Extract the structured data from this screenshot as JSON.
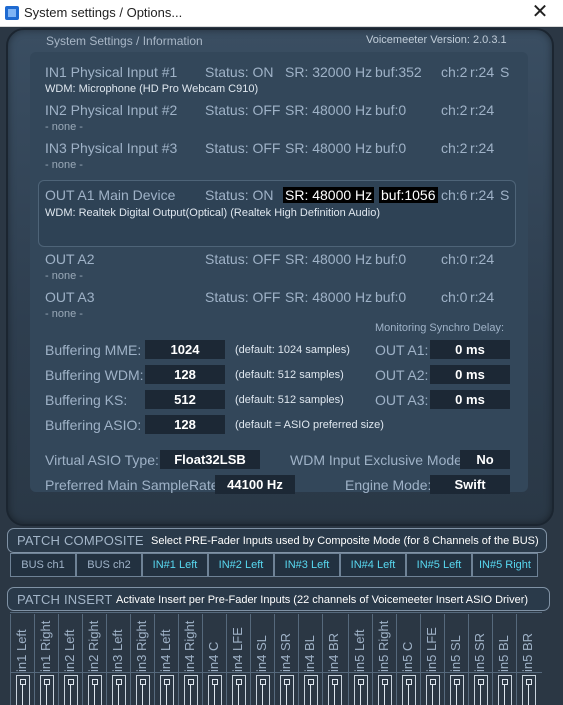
{
  "window": {
    "title": "System settings / Options...",
    "close": "✕"
  },
  "header": {
    "left": "System Settings / Information",
    "right": "Voicemeeter Version: 2.0.3.1"
  },
  "devices": [
    {
      "name": "IN1 Physical Input #1",
      "status": "Status: ON",
      "sr": "SR: 32000 Hz",
      "buf": "buf:352",
      "ch": "ch:2",
      "r": "r:24",
      "s": "S",
      "driver": "WDM: Microphone (HD Pro Webcam C910)"
    },
    {
      "name": "IN2 Physical Input #2",
      "status": "Status: OFF",
      "sr": "SR: 48000 Hz",
      "buf": "buf:0",
      "ch": "ch:2",
      "r": "r:24",
      "s": "",
      "driver": "- none -"
    },
    {
      "name": "IN3 Physical Input #3",
      "status": "Status: OFF",
      "sr": "SR: 48000 Hz",
      "buf": "buf:0",
      "ch": "ch:2",
      "r": "r:24",
      "s": "",
      "driver": "- none -"
    },
    {
      "name": "OUT A1 Main Device",
      "status": "Status: ON",
      "sr": "SR: 48000 Hz",
      "buf": "buf:1056",
      "ch": "ch:6",
      "r": "r:24",
      "s": "S",
      "driver": "WDM: Realtek Digital Output(Optical) (Realtek High Definition Audio)"
    },
    {
      "name": "OUT A2",
      "status": "Status: OFF",
      "sr": "SR: 48000 Hz",
      "buf": "buf:0",
      "ch": "ch:0",
      "r": "r:24",
      "s": "",
      "driver": "- none -"
    },
    {
      "name": "OUT A3",
      "status": "Status: OFF",
      "sr": "SR: 48000 Hz",
      "buf": "buf:0",
      "ch": "ch:0",
      "r": "r:24",
      "s": "",
      "driver": "- none -"
    }
  ],
  "buffering": [
    {
      "label": "Buffering MME:",
      "value": "1024",
      "note": "(default: 1024 samples)"
    },
    {
      "label": "Buffering WDM:",
      "value": "128",
      "note": "(default: 512 samples)"
    },
    {
      "label": "Buffering KS:",
      "value": "512",
      "note": "(default: 512 samples)"
    },
    {
      "label": "Buffering ASIO:",
      "value": "128",
      "note": "(default = ASIO preferred size)"
    }
  ],
  "monitoring": {
    "title": "Monitoring Synchro Delay:",
    "rows": [
      {
        "label": "OUT A1:",
        "value": "0 ms"
      },
      {
        "label": "OUT A2:",
        "value": "0 ms"
      },
      {
        "label": "OUT A3:",
        "value": "0 ms"
      }
    ]
  },
  "asio": {
    "label": "Virtual ASIO Type:",
    "value": "Float32LSB"
  },
  "wdm_excl": {
    "label": "WDM Input Exclusive Mode:",
    "value": "No"
  },
  "samplerate": {
    "label": "Preferred Main SampleRate:",
    "value": "44100 Hz"
  },
  "engine": {
    "label": "Engine Mode:",
    "value": "Swift"
  },
  "composite": {
    "title": "PATCH COMPOSITE",
    "desc": "Select PRE-Fader Inputs used by Composite Mode (for 8 Channels of the BUS)",
    "buttons": [
      "BUS ch1",
      "BUS ch2",
      "IN#1 Left",
      "IN#2 Left",
      "IN#3 Left",
      "IN#4 Left",
      "IN#5 Left",
      "IN#5 Right"
    ]
  },
  "insert": {
    "title": "PATCH INSERT",
    "desc": "Activate Insert per Pre-Fader Inputs (22 channels of Voicemeeter Insert ASIO Driver)",
    "channels": [
      "in1 Left",
      "in1 Right",
      "in2 Left",
      "in2 Right",
      "in3 Left",
      "in3 Right",
      "in4 Left",
      "in4 Right",
      "in4 C",
      "in4 LFE",
      "in4 SL",
      "in4 SR",
      "in4 BL",
      "in4 BR",
      "in5 Left",
      "in5 Right",
      "in5 C",
      "in5 LFE",
      "in5 SL",
      "in5 SR",
      "in5 BL",
      "in5 BR"
    ]
  },
  "colors": {
    "accent_cyan": "#58d8f0",
    "panel": "#33475a",
    "value_box": "#1c2835"
  }
}
